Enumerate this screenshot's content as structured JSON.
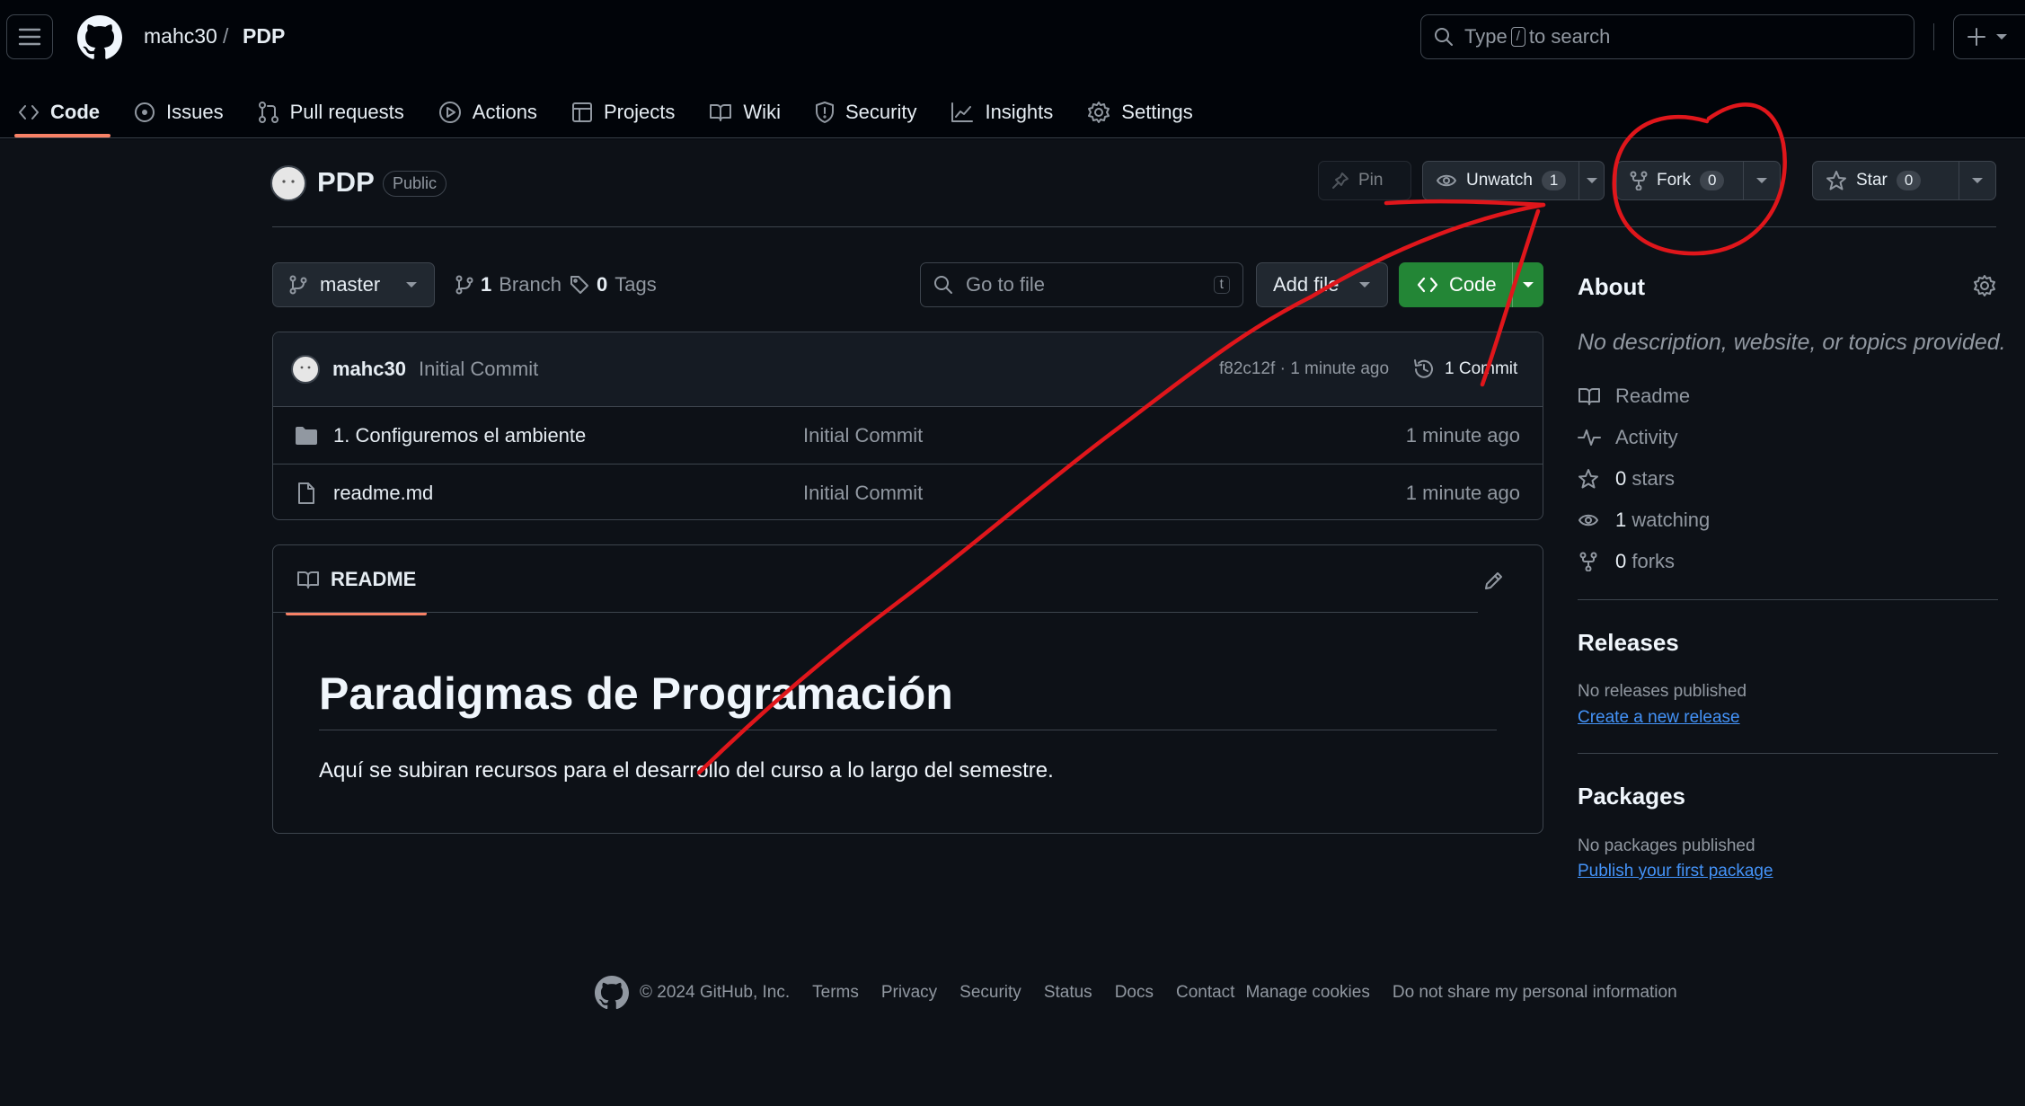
{
  "header": {
    "owner": "mahc30",
    "separator": "/",
    "repo": "PDP",
    "search_placeholder_pre": "Type",
    "search_key": "/",
    "search_placeholder_post": "to search"
  },
  "nav": {
    "code": "Code",
    "issues": "Issues",
    "pulls": "Pull requests",
    "actions": "Actions",
    "projects": "Projects",
    "wiki": "Wiki",
    "security": "Security",
    "insights": "Insights",
    "settings": "Settings"
  },
  "repo": {
    "name": "PDP",
    "visibility": "Public",
    "pin": "Pin",
    "unwatch": "Unwatch",
    "watch_count": "1",
    "fork": "Fork",
    "fork_count": "0",
    "star": "Star",
    "star_count": "0"
  },
  "toolbar": {
    "branch": "master",
    "branch_count": "1",
    "branch_label": "Branch",
    "tag_count": "0",
    "tag_label": "Tags",
    "go_to_file": "Go to file",
    "go_key": "t",
    "add_file": "Add file",
    "code": "Code"
  },
  "commit": {
    "author": "mahc30",
    "message": "Initial Commit",
    "hash_time": "f82c12f · 1 minute ago",
    "commits": "1 Commit"
  },
  "files": [
    {
      "name": "1. Configuremos el ambiente",
      "type": "folder",
      "message": "Initial Commit",
      "time": "1 minute ago"
    },
    {
      "name": "readme.md",
      "type": "file",
      "message": "Initial Commit",
      "time": "1 minute ago"
    }
  ],
  "readme": {
    "tab": "README",
    "heading": "Paradigmas de Programación",
    "paragraph": "Aquí se subiran recursos para el desarrollo del curso a lo largo del semestre."
  },
  "about": {
    "title": "About",
    "description": "No description, website, or topics provided.",
    "readme": "Readme",
    "activity": "Activity",
    "stars_count": "0",
    "stars_label": "stars",
    "watching_count": "1",
    "watching_label": "watching",
    "forks_count": "0",
    "forks_label": "forks"
  },
  "releases": {
    "title": "Releases",
    "none": "No releases published",
    "link": "Create a new release"
  },
  "packages": {
    "title": "Packages",
    "none": "No packages published",
    "link": "Publish your first package"
  },
  "footer": {
    "copyright": "© 2024 GitHub, Inc.",
    "links": [
      "Terms",
      "Privacy",
      "Security",
      "Status",
      "Docs",
      "Contact",
      "Manage cookies",
      "Do not share my personal information"
    ]
  },
  "annotation_color": "#e0161b"
}
